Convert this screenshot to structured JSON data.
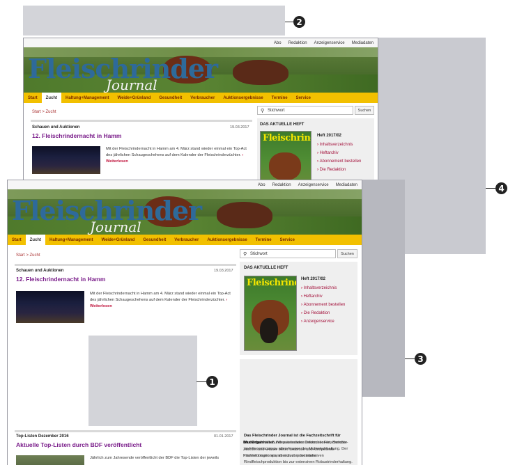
{
  "callouts": {
    "c1": "1",
    "c2": "2",
    "c3": "3",
    "c4": "4"
  },
  "site": {
    "top_links": [
      "Abo",
      "Redaktion",
      "Anzeigenservice",
      "Mediadaten"
    ],
    "logo_main": "Fleischrinder",
    "logo_sub": "Journal",
    "nav": [
      "Start",
      "Zucht",
      "Haltung+Management",
      "Weide+Grünland",
      "Gesundheit",
      "Verbraucher",
      "Auktionsergebnisse",
      "Termine",
      "Service"
    ],
    "nav_active": "Zucht",
    "breadcrumb": "Start > Zucht",
    "article1": {
      "kicker": "Schauen und Auktionen",
      "date": "19.03.2017",
      "headline": "12. Fleischrindernacht in Hamm",
      "teaser": "Mit der Fleischrindernacht in Hamm am 4. März stand wieder einmal ein Top-Act des jährlichen Schaugeschehens auf dem Kalender der Fleischrinderzüchter.",
      "more": "Weiterlesen"
    },
    "article2": {
      "kicker": "Top-Listen Dezember 2016",
      "date": "01.01.2017",
      "headline": "Aktuelle Top-Listen durch BDF veröffentlicht",
      "teaser": "Jährlich zum Jahresende veröffentlicht der BDF die Top-Listen der jeweils"
    },
    "search": {
      "placeholder": "Stichwort",
      "button": "Suchen"
    },
    "sidebar": {
      "heading": "DAS AKTUELLE HEFT",
      "cover_title": "Fleischrinder",
      "issue": "Heft 2017/02",
      "links": [
        "Inhaltsverzeichnis",
        "Heftarchiv",
        "Abonnement bestellen",
        "Die Redaktion",
        "Anzeigenservice"
      ],
      "about_title": "Das Fleischrinder Journal ist die Fachzeitschrift für Mutterkuhhalter.",
      "about_text": "Wir präsentieren Informationen, Berichte und Reportagen zu allen Fragen der Mutterkuhhaltung. Der Themenbogen spannt sich von der intensiven Rindfleischproduktion bis zur extensiven Robustrinderhaltung. Fragen der Zucht und Haltung werden aufgegriffen, wie auch verbraucherrelevante Themen rund ums Rindfleisch und zur Landschaftspflege.",
      "about_title2": "Das Organ",
      "about_text2": "des Bundesverbandes Deutscher Fleischrinder-Züchter und -Halter bietet wertvolle und kompetente Fachinformationen, aber auch praxisnahe"
    }
  }
}
